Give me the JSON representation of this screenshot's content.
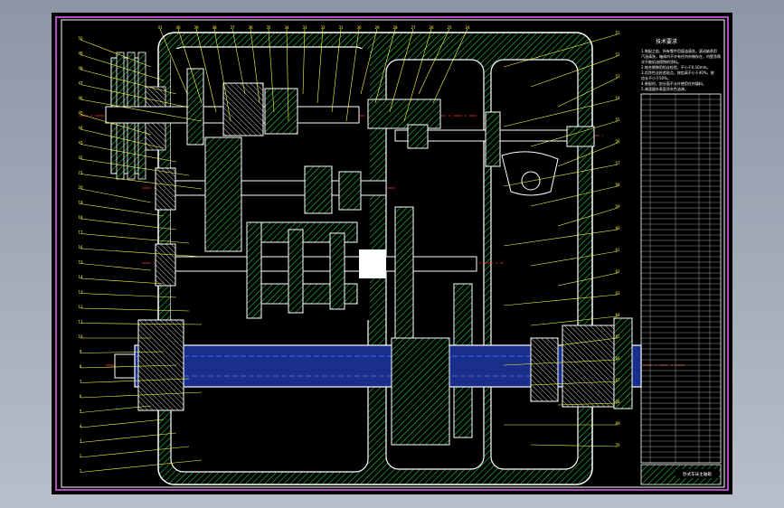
{
  "drawing": {
    "tech_requirements": {
      "title": "技术要求",
      "lines": [
        "1.装配之前，所有零件用煤油清洗，滚动轴承用",
        "汽油清洗，箱体内不许有任何杂物存在，内壁涂两",
        "次不被机油侵蚀的涂料。",
        "2.啮合侧隙用铅丝检验，不小于0.16mm。",
        "3.用涂色法检验斑点，按齿高不小于40%，按",
        "齿长不小于50%。",
        "4.装配时，剖分面不允许使用任何填料。",
        "5.减速器外表面涂灰色油漆。"
      ]
    },
    "title_block": {
      "title": "卧式车床主轴箱"
    },
    "shaft_labels": [
      "轴I",
      "轴II",
      "轴III",
      "轴IV",
      "主轴"
    ],
    "balloons_top": [
      "41",
      "40",
      "39",
      "38",
      "37",
      "36",
      "35",
      "34",
      "33",
      "32",
      "31",
      "30",
      "29",
      "28",
      "27",
      "26",
      "25",
      "24"
    ],
    "balloons_left": [
      "50",
      "49",
      "48",
      "47",
      "46",
      "45",
      "44",
      "43",
      "42",
      "21",
      "20",
      "19",
      "18",
      "17",
      "16",
      "15",
      "14",
      "13",
      "12",
      "11",
      "10",
      "9",
      "8",
      "7",
      "6",
      "5",
      "4",
      "3",
      "2",
      "1"
    ],
    "balloons_right": [
      "51",
      "52",
      "53",
      "54",
      "55",
      "56",
      "57",
      "58",
      "59",
      "60",
      "61",
      "62",
      "63",
      "64",
      "65",
      "66",
      "67",
      "68",
      "69",
      "70"
    ]
  },
  "colors": {
    "background": "#000000",
    "outline": "#ffffff",
    "hatch": "#22c84a",
    "leader": "#ffff40",
    "centerline": "#ff3030",
    "frame_border": "#b04cc0",
    "shaft_fill": "#2040c8"
  }
}
